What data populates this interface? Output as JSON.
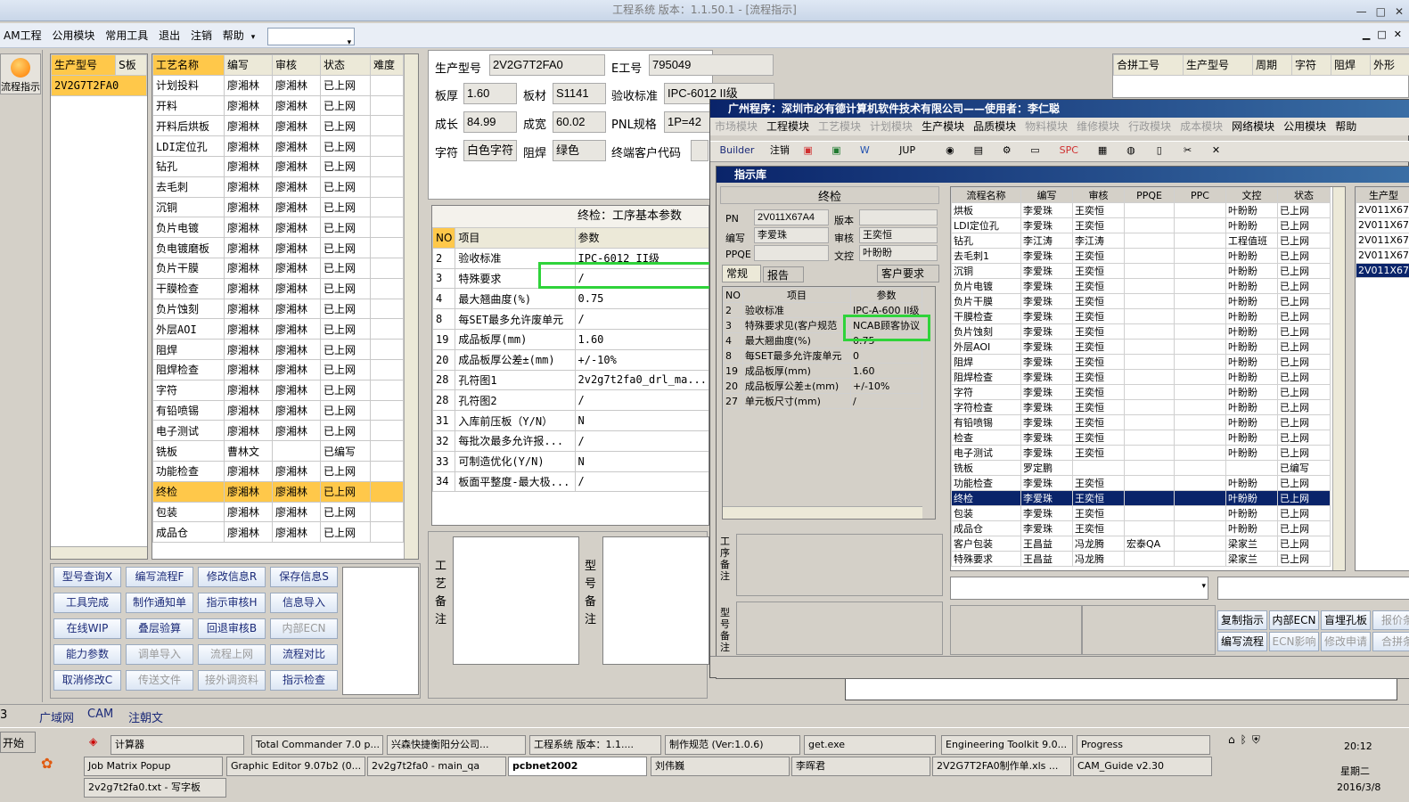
{
  "app": {
    "title": "工程系统   版本：1.1.50.1 - [流程指示]",
    "win_min": "—",
    "win_max": "□",
    "win_close": "✕"
  },
  "menu": {
    "items": [
      "AM工程",
      "公用模块",
      "常用工具",
      "退出",
      "注销",
      "帮助"
    ],
    "mdi_min": "▁",
    "mdi_max": "□",
    "mdi_close": "✕"
  },
  "sidebar": {
    "label": "流程指示"
  },
  "models": {
    "headers": [
      "生产型号",
      "S板"
    ],
    "rows": [
      [
        "2V2G7T2FA0",
        ""
      ]
    ]
  },
  "process": {
    "headers": [
      "工艺名称",
      "编写",
      "审核",
      "状态",
      "难度"
    ],
    "rows": [
      [
        "计划投料",
        "廖湘林",
        "廖湘林",
        "已上网"
      ],
      [
        "开料",
        "廖湘林",
        "廖湘林",
        "已上网"
      ],
      [
        "开料后烘板",
        "廖湘林",
        "廖湘林",
        "已上网"
      ],
      [
        "LDI定位孔",
        "廖湘林",
        "廖湘林",
        "已上网"
      ],
      [
        "钻孔",
        "廖湘林",
        "廖湘林",
        "已上网"
      ],
      [
        "去毛刺",
        "廖湘林",
        "廖湘林",
        "已上网"
      ],
      [
        "沉铜",
        "廖湘林",
        "廖湘林",
        "已上网"
      ],
      [
        "负片电镀",
        "廖湘林",
        "廖湘林",
        "已上网"
      ],
      [
        "负电镀磨板",
        "廖湘林",
        "廖湘林",
        "已上网"
      ],
      [
        "负片干膜",
        "廖湘林",
        "廖湘林",
        "已上网"
      ],
      [
        "干膜检查",
        "廖湘林",
        "廖湘林",
        "已上网"
      ],
      [
        "负片蚀刻",
        "廖湘林",
        "廖湘林",
        "已上网"
      ],
      [
        "外层AOI",
        "廖湘林",
        "廖湘林",
        "已上网"
      ],
      [
        "阻焊",
        "廖湘林",
        "廖湘林",
        "已上网"
      ],
      [
        "阻焊检查",
        "廖湘林",
        "廖湘林",
        "已上网"
      ],
      [
        "字符",
        "廖湘林",
        "廖湘林",
        "已上网"
      ],
      [
        "有铅喷锡",
        "廖湘林",
        "廖湘林",
        "已上网"
      ],
      [
        "电子测试",
        "廖湘林",
        "廖湘林",
        "已上网"
      ],
      [
        "铣板",
        "曹林文",
        "",
        "已编写"
      ],
      [
        "功能检查",
        "廖湘林",
        "廖湘林",
        "已上网"
      ],
      [
        "终检",
        "廖湘林",
        "廖湘林",
        "已上网"
      ],
      [
        "包装",
        "廖湘林",
        "廖湘林",
        "已上网"
      ],
      [
        "成品仓",
        "廖湘林",
        "廖湘林",
        "已上网"
      ]
    ]
  },
  "buttons": [
    "型号查询X",
    "编写流程F",
    "修改信息R",
    "保存信息S",
    "工具完成",
    "制作通知单",
    "指示审核H",
    "信息导入",
    "在线WIP",
    "叠层验算",
    "回退审核B",
    "内部ECN",
    "能力参数",
    "调单导入",
    "流程上网",
    "流程对比",
    "取消修改C",
    "传送文件",
    "接外调资料",
    "指示检查"
  ],
  "info": {
    "l_model": "生产型号",
    "model": "2V2G7T2FA0",
    "l_e": "E工号",
    "e": "795049",
    "l_thick": "板厚",
    "thick": "1.60",
    "l_mat": "板材",
    "mat": "S1141",
    "l_std": "验收标准",
    "std": "IPC-6012 II级",
    "l_len": "成长",
    "len": "84.99",
    "l_wid": "成宽",
    "wid": "60.02",
    "l_pnl": "PNL规格",
    "pnl": "1P=42",
    "l_char": "字符",
    "char": "白色字符",
    "l_mask": "阻焊",
    "mask": "绿色",
    "l_cust": "终端客户代码"
  },
  "params": {
    "title": "终检：工序基本参数",
    "headers": [
      "NO",
      "项目",
      "参数"
    ],
    "rows": [
      [
        "2",
        "验收标准",
        "IPC-6012 II级"
      ],
      [
        "3",
        "特殊要求",
        "/"
      ],
      [
        "4",
        "最大翘曲度(%)",
        "0.75"
      ],
      [
        "8",
        "每SET最多允许废单元",
        "/"
      ],
      [
        "19",
        "成品板厚(mm)",
        "1.60"
      ],
      [
        "20",
        "成品板厚公差±(mm)",
        "+/-10%"
      ],
      [
        "28",
        "孔符图1",
        "2v2g7t2fa0_drl_ma..."
      ],
      [
        "28",
        "孔符图2",
        "/"
      ],
      [
        "31",
        "入库前压板（Y/N）",
        "N"
      ],
      [
        "32",
        "每批次最多允许报...",
        "/"
      ],
      [
        "33",
        "可制造优化(Y/N)",
        "N"
      ],
      [
        "34",
        "板面平整度-最大极...",
        "/"
      ]
    ]
  },
  "notes": {
    "craft": "工艺备注",
    "model": "型号备注"
  },
  "merge": {
    "headers": [
      "合拼工号",
      "生产型号",
      "周期",
      "字符",
      "阻焊",
      "外形"
    ]
  },
  "dialog": {
    "title": "广州程序：深圳市必有德计算机软件技术有限公司——使用者：李仁聪",
    "menu": [
      "市场模块",
      "工程模块",
      "工艺模块",
      "计划模块",
      "生产模块",
      "品质模块",
      "物料模块",
      "维修模块",
      "行政模块",
      "成本模块",
      "网络模块",
      "公用模块",
      "帮助"
    ],
    "builder": "Builder",
    "logout": "注销",
    "spc": "SPC",
    "jup": "JUP",
    "sub_title": "指示库",
    "step": "终检",
    "pn_l": "PN",
    "pn": "2V011X67A4",
    "ver_l": "版本",
    "ver": "",
    "auth_l": "编写",
    "auth": "李爱珠",
    "rev_l": "审核",
    "rev": "王奕恒",
    "ppqe_l": "PPQE",
    "ppqe": "",
    "ctrl_l": "文控",
    "ctrl": "叶盼盼",
    "tabs": [
      "常规",
      "报告",
      "客户要求"
    ],
    "p_headers": [
      "NO",
      "项目",
      "参数"
    ],
    "p_rows": [
      [
        "2",
        "验收标准",
        "IPC-A-600 II级"
      ],
      [
        "3",
        "特殊要求见(客户规范",
        "NCAB顾客协议"
      ],
      [
        "4",
        "最大翘曲度(%)",
        "0.75"
      ],
      [
        "8",
        "每SET最多允许废单元",
        "0"
      ],
      [
        "19",
        "成品板厚(mm)",
        "1.60"
      ],
      [
        "20",
        "成品板厚公差±(mm)",
        "+/-10%"
      ],
      [
        "27",
        "单元板尺寸(mm)",
        "/"
      ]
    ],
    "note1": "工序备注",
    "note2": "型号备注",
    "f_headers": [
      "流程名称",
      "编写",
      "审核",
      "PPQE",
      "PPC",
      "文控",
      "状态"
    ],
    "f_rows": [
      [
        "烘板",
        "李爱珠",
        "王奕恒",
        "",
        "",
        "叶盼盼",
        "已上网"
      ],
      [
        "LDI定位孔",
        "李爱珠",
        "王奕恒",
        "",
        "",
        "叶盼盼",
        "已上网"
      ],
      [
        "钻孔",
        "李江涛",
        "李江涛",
        "",
        "",
        "工程值班",
        "已上网"
      ],
      [
        "去毛刺1",
        "李爱珠",
        "王奕恒",
        "",
        "",
        "叶盼盼",
        "已上网"
      ],
      [
        "沉铜",
        "李爱珠",
        "王奕恒",
        "",
        "",
        "叶盼盼",
        "已上网"
      ],
      [
        "负片电镀",
        "李爱珠",
        "王奕恒",
        "",
        "",
        "叶盼盼",
        "已上网"
      ],
      [
        "负片干膜",
        "李爱珠",
        "王奕恒",
        "",
        "",
        "叶盼盼",
        "已上网"
      ],
      [
        "干膜检查",
        "李爱珠",
        "王奕恒",
        "",
        "",
        "叶盼盼",
        "已上网"
      ],
      [
        "负片蚀刻",
        "李爱珠",
        "王奕恒",
        "",
        "",
        "叶盼盼",
        "已上网"
      ],
      [
        "外层AOI",
        "李爱珠",
        "王奕恒",
        "",
        "",
        "叶盼盼",
        "已上网"
      ],
      [
        "阻焊",
        "李爱珠",
        "王奕恒",
        "",
        "",
        "叶盼盼",
        "已上网"
      ],
      [
        "阻焊检查",
        "李爱珠",
        "王奕恒",
        "",
        "",
        "叶盼盼",
        "已上网"
      ],
      [
        "字符",
        "李爱珠",
        "王奕恒",
        "",
        "",
        "叶盼盼",
        "已上网"
      ],
      [
        "字符检查",
        "李爱珠",
        "王奕恒",
        "",
        "",
        "叶盼盼",
        "已上网"
      ],
      [
        "有铅喷锡",
        "李爱珠",
        "王奕恒",
        "",
        "",
        "叶盼盼",
        "已上网"
      ],
      [
        "检查",
        "李爱珠",
        "王奕恒",
        "",
        "",
        "叶盼盼",
        "已上网"
      ],
      [
        "电子测试",
        "李爱珠",
        "王奕恒",
        "",
        "",
        "叶盼盼",
        "已上网"
      ],
      [
        "铣板",
        "罗定鹏",
        "",
        "",
        "",
        "",
        "已编写"
      ],
      [
        "功能检查",
        "李爱珠",
        "王奕恒",
        "",
        "",
        "叶盼盼",
        "已上网"
      ],
      [
        "终检",
        "李爱珠",
        "王奕恒",
        "",
        "",
        "叶盼盼",
        "已上网"
      ],
      [
        "包装",
        "李爱珠",
        "王奕恒",
        "",
        "",
        "叶盼盼",
        "已上网"
      ],
      [
        "成品仓",
        "李爱珠",
        "王奕恒",
        "",
        "",
        "叶盼盼",
        "已上网"
      ],
      [
        "客户包装",
        "王昌益",
        "冯龙腾",
        "宏泰QA",
        "",
        "梁家兰",
        "已上网"
      ],
      [
        "特殊要求",
        "王昌益",
        "冯龙腾",
        "",
        "",
        "梁家兰",
        "已上网"
      ]
    ],
    "r_header": "生产型",
    "r_rows": [
      "2V011X67",
      "2V011X67",
      "2V011X67",
      "2V011X67",
      "2V011X67"
    ],
    "r_buttons": [
      "复制指示",
      "内部ECN",
      "盲埋孔板",
      "报价条",
      "编写流程",
      "ECN影响",
      "修改申请",
      "合拼条"
    ]
  },
  "status": {
    "items": [
      "3",
      "广域网",
      "CAM",
      "注朝文"
    ]
  },
  "taskbar": {
    "start": "开始",
    "items": [
      "计算器",
      "Total Commander 7.0 p...",
      "兴森快捷衡阳分公司...",
      "工程系统  版本：1.1....",
      "制作规范 (Ver:1.0.6)",
      "get.exe",
      "Engineering Toolkit 9.0...",
      "Progress",
      "Job Matrix Popup",
      "Graphic Editor 9.07b2 (0...",
      "2v2g7t2fa0 - main_qa",
      "pcbnet2002",
      "刘伟巍",
      "李晖君",
      "2V2G7T2FA0制作单.xls ...",
      "CAM_Guide v2.30",
      "2v2g7t2fa0.txt - 写字板"
    ],
    "time": "20:12",
    "day": "星期二",
    "date": "2016/3/8"
  }
}
